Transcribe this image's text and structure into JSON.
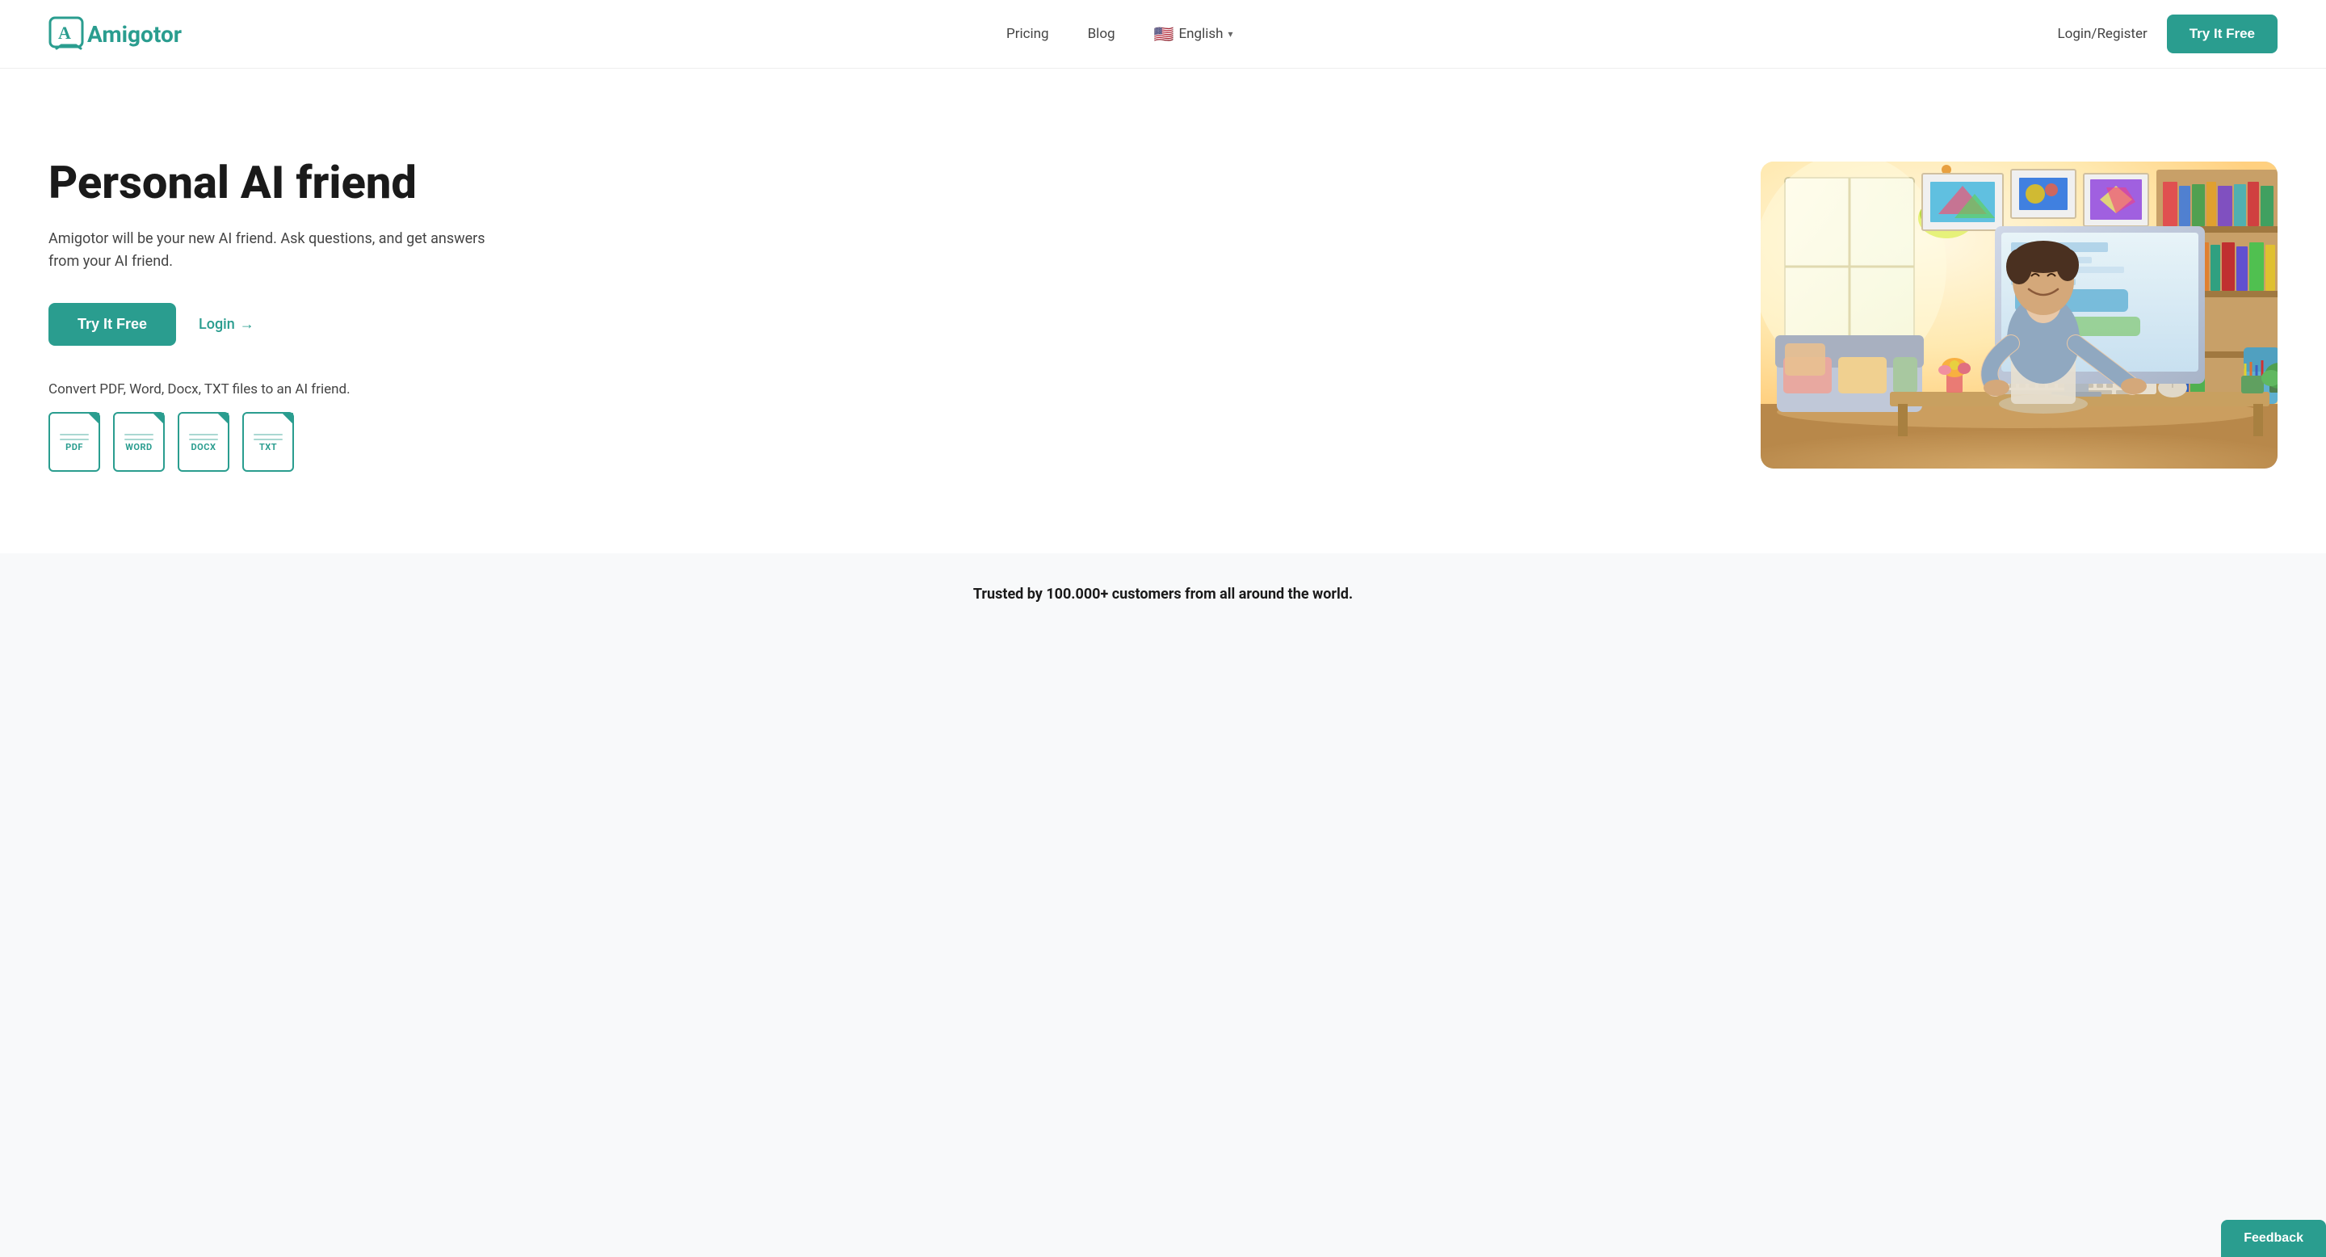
{
  "brand": {
    "name": "Amigotor",
    "logo_letter": "A"
  },
  "nav": {
    "pricing_label": "Pricing",
    "blog_label": "Blog",
    "language_label": "English",
    "login_register_label": "Login/Register",
    "try_btn_label": "Try It Free"
  },
  "hero": {
    "title": "Personal AI friend",
    "description": "Amigotor will be your new AI friend. Ask questions, and get answers from your AI friend.",
    "try_btn_label": "Try It Free",
    "login_label": "Login",
    "login_arrow": "→",
    "convert_label": "Convert PDF, Word, Docx, TXT files to an AI friend.",
    "file_types": [
      {
        "label": "PDF"
      },
      {
        "label": "WORD"
      },
      {
        "label": "DOCX"
      },
      {
        "label": "TXT"
      }
    ]
  },
  "trust": {
    "text": "Trusted by 100.000+ customers from all around the world."
  },
  "feedback": {
    "label": "Feedback"
  },
  "colors": {
    "primary": "#2a9d8f",
    "text_dark": "#1a1a1a",
    "text_mid": "#444444"
  }
}
